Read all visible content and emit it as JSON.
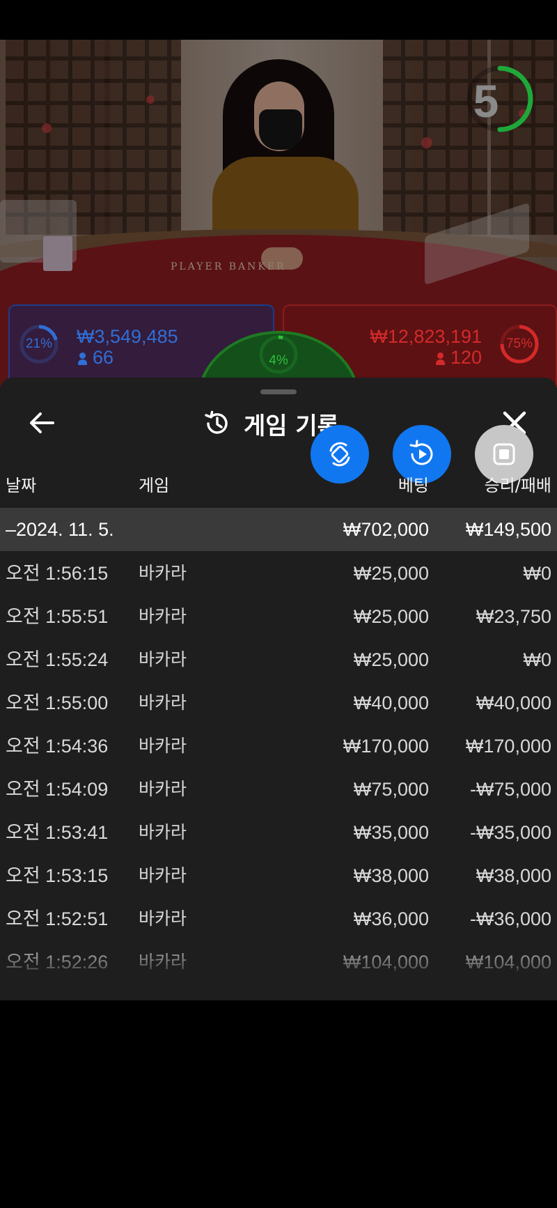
{
  "video": {
    "countdown": "5",
    "countdown_progress": 0.5,
    "table_text": "PLAYER   BANKER",
    "player": {
      "percent": "21%",
      "percent_value": 0.21,
      "amount": "₩3,549,485",
      "players": "66",
      "color": "#2f6fd6"
    },
    "tie": {
      "percent": "4%",
      "percent_value": 0.04,
      "color": "#2fbf3a"
    },
    "banker": {
      "percent": "75%",
      "percent_value": 0.75,
      "amount": "₩12,823,191",
      "players": "120",
      "color": "#d42a2a"
    }
  },
  "sheet": {
    "title": "게임 기록",
    "back_icon": "arrow-left-icon",
    "history_icon": "history-icon",
    "close_icon": "close-icon",
    "fabs": [
      {
        "name": "rotate-icon",
        "color": "#1177f0"
      },
      {
        "name": "replay-icon",
        "color": "#1177f0"
      },
      {
        "name": "stop-icon",
        "color": "#c7c7c7"
      }
    ],
    "columns": {
      "date": "날짜",
      "game": "게임",
      "bet": "베팅",
      "result": "승리/패배"
    },
    "group": {
      "date": "–2024. 11. 5.",
      "bet_total": "₩702,000",
      "result_total": "₩149,500"
    },
    "rows": [
      {
        "time": "오전 1:56:15",
        "game": "바카라",
        "bet": "₩25,000",
        "result": "₩0"
      },
      {
        "time": "오전 1:55:51",
        "game": "바카라",
        "bet": "₩25,000",
        "result": "₩23,750"
      },
      {
        "time": "오전 1:55:24",
        "game": "바카라",
        "bet": "₩25,000",
        "result": "₩0"
      },
      {
        "time": "오전 1:55:00",
        "game": "바카라",
        "bet": "₩40,000",
        "result": "₩40,000"
      },
      {
        "time": "오전 1:54:36",
        "game": "바카라",
        "bet": "₩170,000",
        "result": "₩170,000"
      },
      {
        "time": "오전 1:54:09",
        "game": "바카라",
        "bet": "₩75,000",
        "result": "-₩75,000"
      },
      {
        "time": "오전 1:53:41",
        "game": "바카라",
        "bet": "₩35,000",
        "result": "-₩35,000"
      },
      {
        "time": "오전 1:53:15",
        "game": "바카라",
        "bet": "₩38,000",
        "result": "₩38,000"
      },
      {
        "time": "오전 1:52:51",
        "game": "바카라",
        "bet": "₩36,000",
        "result": "-₩36,000"
      },
      {
        "time": "오전 1:52:26",
        "game": "바카라",
        "bet": "₩104,000",
        "result": "₩104,000"
      }
    ]
  }
}
